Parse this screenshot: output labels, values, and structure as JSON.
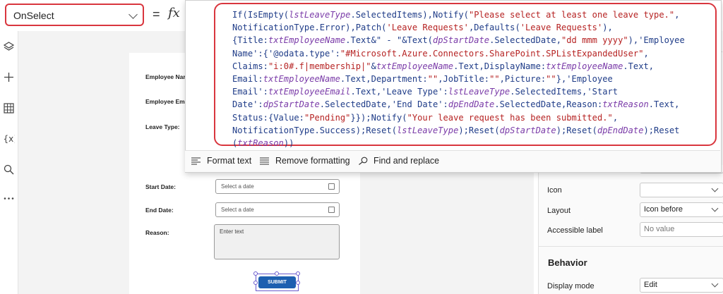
{
  "formula_bar": {
    "property": "OnSelect",
    "equals": "=",
    "fx": "fx"
  },
  "formula": {
    "code_segments": [
      {
        "t": "If(IsEmpty(",
        "c": "k"
      },
      {
        "t": "lstLeaveType",
        "c": "v"
      },
      {
        "t": ".SelectedItems),Notify(",
        "c": "k"
      },
      {
        "t": "\"Please select at least one leave type.\"",
        "c": "s"
      },
      {
        "t": ",\nNotificationType.Error),Patch(",
        "c": "k"
      },
      {
        "t": "'Leave Requests'",
        "c": "s"
      },
      {
        "t": ",Defaults(",
        "c": "k"
      },
      {
        "t": "'Leave Requests'",
        "c": "s"
      },
      {
        "t": "),\n{Title:",
        "c": "k"
      },
      {
        "t": "txtEmployeeName",
        "c": "v"
      },
      {
        "t": ".Text&\" - \"&Text(",
        "c": "k"
      },
      {
        "t": "dpStartDate",
        "c": "v"
      },
      {
        "t": ".SelectedDate,",
        "c": "k"
      },
      {
        "t": "\"dd mmm yyyy\"",
        "c": "s"
      },
      {
        "t": "),'Employee\nName':{'@odata.type':",
        "c": "k"
      },
      {
        "t": "\"#Microsoft.Azure.Connectors.SharePoint.SPListExpandedUser\"",
        "c": "s"
      },
      {
        "t": ",\nClaims:",
        "c": "k"
      },
      {
        "t": "\"i:0#.f|membership|\"",
        "c": "s"
      },
      {
        "t": "&",
        "c": "k"
      },
      {
        "t": "txtEmployeeName",
        "c": "v"
      },
      {
        "t": ".Text,DisplayName:",
        "c": "k"
      },
      {
        "t": "txtEmployeeName",
        "c": "v"
      },
      {
        "t": ".Text,\nEmail:",
        "c": "k"
      },
      {
        "t": "txtEmployeeName",
        "c": "v"
      },
      {
        "t": ".Text,Department:",
        "c": "k"
      },
      {
        "t": "\"\"",
        "c": "s"
      },
      {
        "t": ",JobTitle:",
        "c": "k"
      },
      {
        "t": "\"\"",
        "c": "s"
      },
      {
        "t": ",Picture:",
        "c": "k"
      },
      {
        "t": "\"\"",
        "c": "s"
      },
      {
        "t": "},'Employee\nEmail':",
        "c": "k"
      },
      {
        "t": "txtEmployeeEmail",
        "c": "v"
      },
      {
        "t": ".Text,'Leave Type':",
        "c": "k"
      },
      {
        "t": "lstLeaveType",
        "c": "v"
      },
      {
        "t": ".SelectedItems,'Start\nDate':",
        "c": "k"
      },
      {
        "t": "dpStartDate",
        "c": "v"
      },
      {
        "t": ".SelectedDate,'End Date':",
        "c": "k"
      },
      {
        "t": "dpEndDate",
        "c": "v"
      },
      {
        "t": ".SelectedDate,Reason:",
        "c": "k"
      },
      {
        "t": "txtReason",
        "c": "v"
      },
      {
        "t": ".Text,\nStatus:{Value:",
        "c": "k"
      },
      {
        "t": "\"Pending\"",
        "c": "s"
      },
      {
        "t": "}});Notify(",
        "c": "k"
      },
      {
        "t": "\"Your leave request has been submitted.\"",
        "c": "s"
      },
      {
        "t": ",\nNotificationType.Success);Reset(",
        "c": "k"
      },
      {
        "t": "lstLeaveType",
        "c": "v"
      },
      {
        "t": ");Reset(",
        "c": "k"
      },
      {
        "t": "dpStartDate",
        "c": "v"
      },
      {
        "t": ");Reset(",
        "c": "k"
      },
      {
        "t": "dpEndDate",
        "c": "v"
      },
      {
        "t": ");Reset\n(",
        "c": "k"
      },
      {
        "t": "txtReason",
        "c": "v"
      },
      {
        "t": ")) ",
        "c": "k"
      }
    ]
  },
  "editor_tools": {
    "format_text": "Format text",
    "remove_formatting": "Remove formatting",
    "find_replace": "Find and replace"
  },
  "form": {
    "employee_name_label": "Employee Nar",
    "employee_email_label": "Employee Ema",
    "leave_type_label": "Leave Type:",
    "start_date_label": "Start Date:",
    "end_date_label": "End Date:",
    "reason_label": "Reason:",
    "start_date_placeholder": "Select a date",
    "end_date_placeholder": "Select a date",
    "reason_placeholder": "Enter text",
    "submit_label": "SUBMIT"
  },
  "properties": {
    "icon_label": "Icon",
    "icon_value": "",
    "layout_label": "Layout",
    "layout_value": "Icon before",
    "accessible_label": "Accessible label",
    "accessible_value": "No value",
    "behavior_heading": "Behavior",
    "display_mode_label": "Display mode",
    "display_mode_value": "Edit"
  },
  "colors": {
    "highlight": "#d9363e",
    "submit_button": "#1d5fb0",
    "code_keyword": "#1f3c88",
    "code_string": "#b62323",
    "code_variable": "#7a3ba8"
  },
  "icons": [
    "layers-icon",
    "plus-icon",
    "table-icon",
    "variables-icon",
    "search-icon",
    "more-icon",
    "copilot-icon",
    "format-text-icon",
    "remove-formatting-icon",
    "find-replace-icon",
    "calendar-icon"
  ]
}
